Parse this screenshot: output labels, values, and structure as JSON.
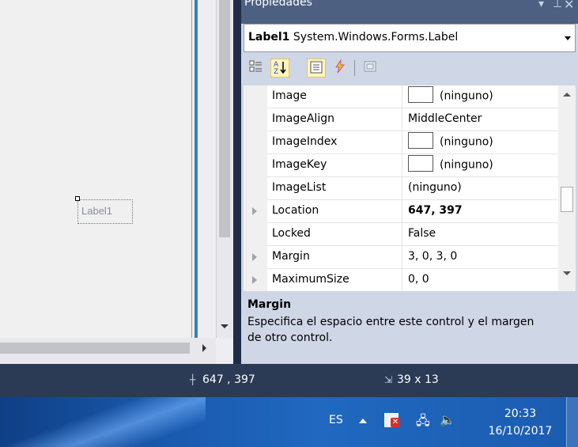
{
  "designer": {
    "label_text": "Label1"
  },
  "properties_panel": {
    "title": "Propiedades",
    "icons": {
      "pin": "pin-icon",
      "close": "close-icon"
    },
    "object_selector": {
      "name": "Label1",
      "type": "System.Windows.Forms.Label"
    },
    "toolbar": {
      "categorized": "categorized-icon",
      "alphabetical": "alphabetical-sort-icon",
      "properties": "properties-icon",
      "events": "events-lightning-icon",
      "property_pages": "property-pages-icon"
    },
    "rows": [
      {
        "name": "Image",
        "value": "(ninguno)",
        "swatch": true,
        "expandable": false,
        "bold": false
      },
      {
        "name": "ImageAlign",
        "value": "MiddleCenter",
        "swatch": false,
        "expandable": false,
        "bold": false
      },
      {
        "name": "ImageIndex",
        "value": "(ninguno)",
        "swatch": true,
        "expandable": false,
        "bold": false
      },
      {
        "name": "ImageKey",
        "value": "(ninguno)",
        "swatch": true,
        "expandable": false,
        "bold": false
      },
      {
        "name": "ImageList",
        "value": "(ninguno)",
        "swatch": false,
        "expandable": false,
        "bold": false
      },
      {
        "name": "Location",
        "value": "647, 397",
        "swatch": false,
        "expandable": true,
        "bold": true
      },
      {
        "name": "Locked",
        "value": "False",
        "swatch": false,
        "expandable": false,
        "bold": false
      },
      {
        "name": "Margin",
        "value": "3, 0, 3, 0",
        "swatch": false,
        "expandable": true,
        "bold": false,
        "selected": true
      },
      {
        "name": "MaximumSize",
        "value": "0, 0",
        "swatch": false,
        "expandable": true,
        "bold": false
      }
    ],
    "description": {
      "title": "Margin",
      "text": "Especifica el espacio entre este control y el margen de otro control."
    }
  },
  "statusbar": {
    "location": "647 , 397",
    "size": "39 x 13"
  },
  "taskbar": {
    "language": "ES",
    "time": "20:33",
    "date": "16/10/2017"
  }
}
